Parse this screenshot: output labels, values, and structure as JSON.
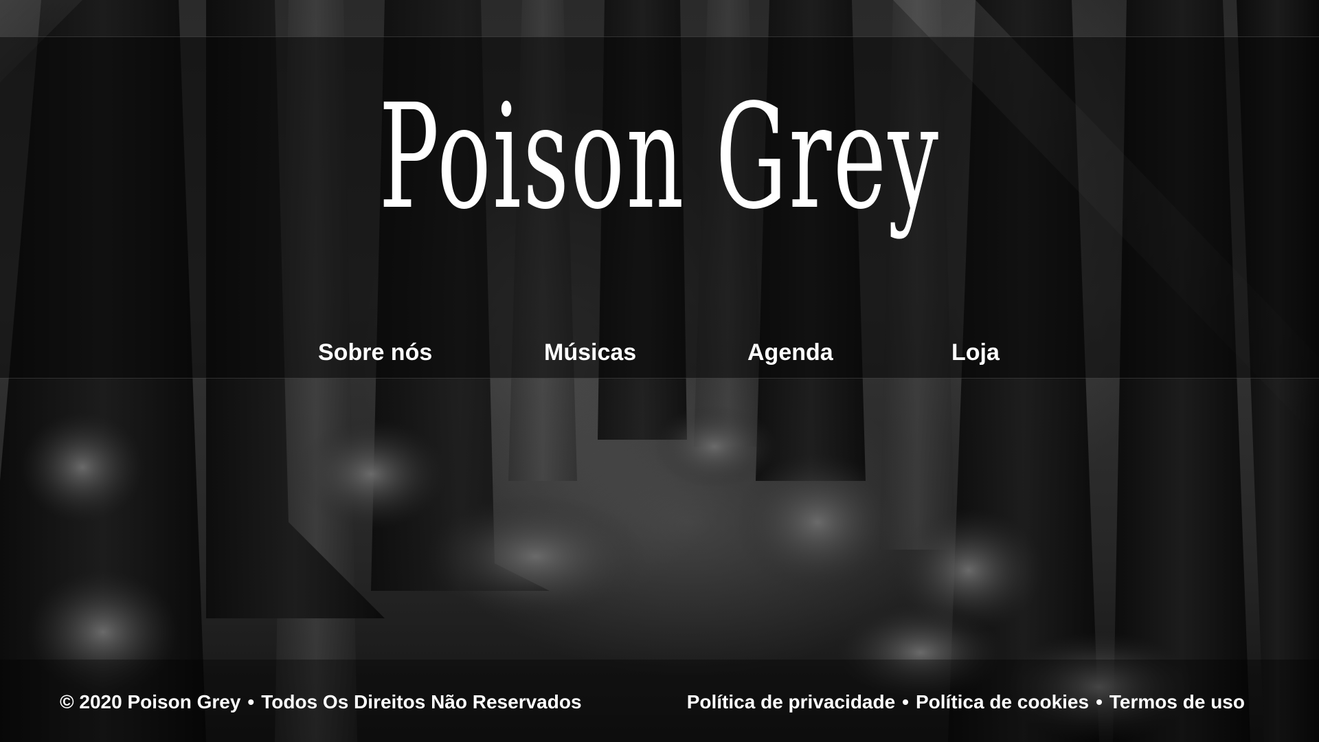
{
  "site": {
    "logo_text": "Poison Grey"
  },
  "nav": {
    "items": [
      {
        "label": "Sobre nós"
      },
      {
        "label": "Músicas"
      },
      {
        "label": "Agenda"
      },
      {
        "label": "Loja"
      }
    ]
  },
  "footer": {
    "copyright": "© 2020 Poison Grey",
    "rights": "Todos Os Direitos Não Reservados",
    "separator": "•",
    "links": {
      "privacy": "Política de privacidade",
      "cookies": "Política de cookies",
      "terms": "Termos de uso"
    }
  },
  "colors": {
    "text": "#ffffff",
    "background": "#2a2a2a",
    "header_overlay": "#080808"
  }
}
